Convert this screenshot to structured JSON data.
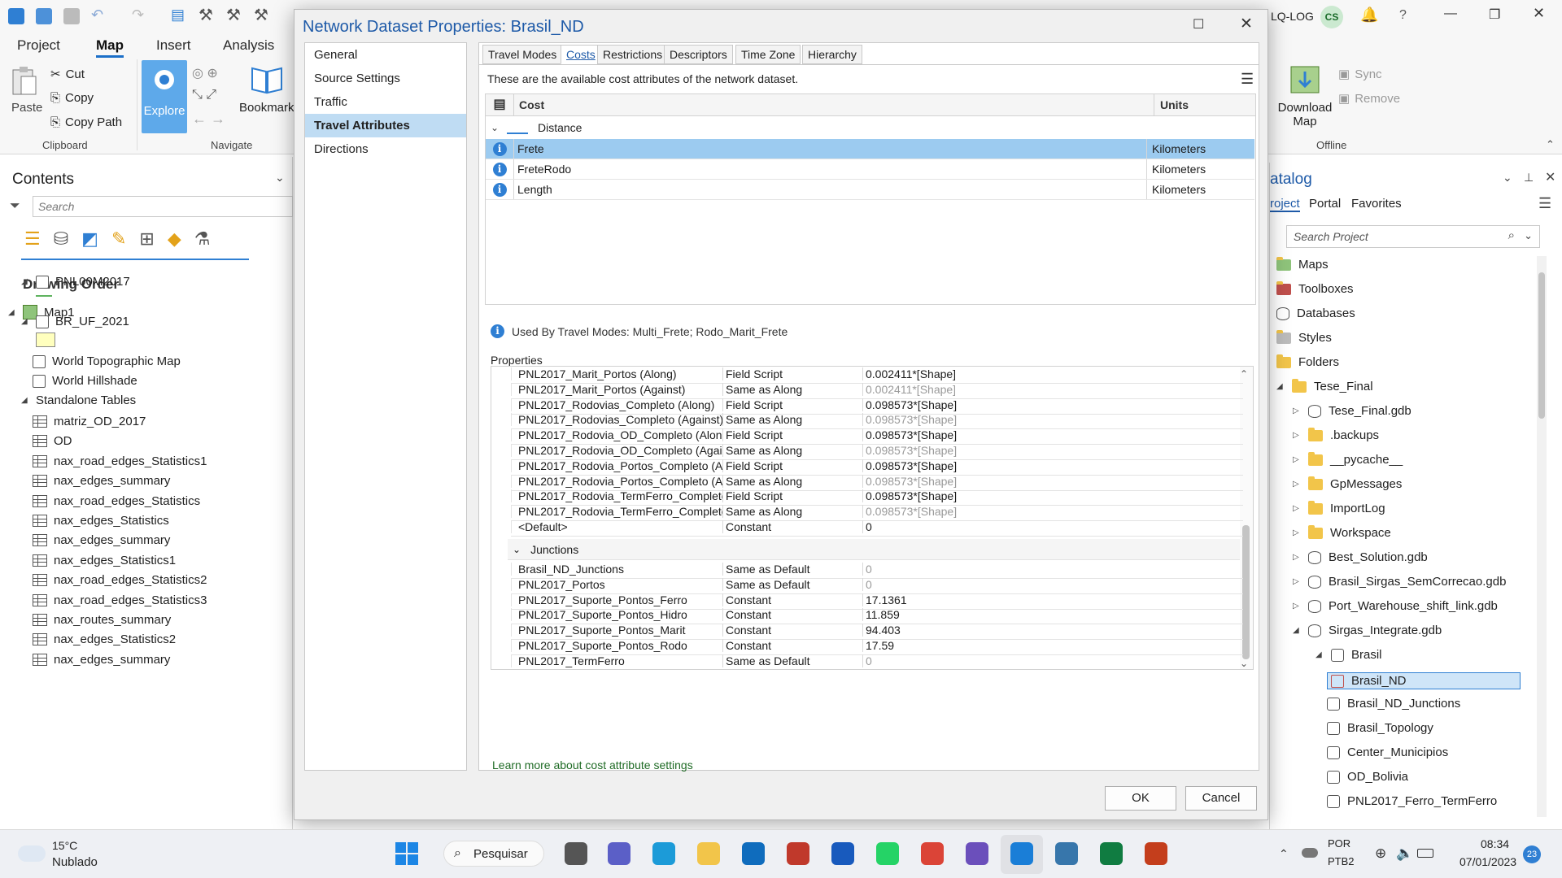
{
  "ribbon": {
    "tabs": [
      "Project",
      "Map",
      "Insert",
      "Analysis"
    ],
    "active_tab": "Map",
    "clipboard": {
      "paste": "Paste",
      "cut": "Cut",
      "copy": "Copy",
      "copy_path": "Copy Path",
      "group": "Clipboard"
    },
    "navigate": {
      "explore": "Explore",
      "bookmarks": "Bookmarks",
      "group": "Navigate"
    },
    "account": {
      "org": "LQ-LOG",
      "initials": "CS"
    },
    "offline": {
      "download_map": "Download Map",
      "sync": "Sync",
      "remove": "Remove",
      "group": "Offline"
    }
  },
  "contents": {
    "title": "Contents",
    "search_placeholder": "Search",
    "drawing_order": "Drawing Order",
    "map": "Map1",
    "layers": [
      "PNL00M2017",
      "BR_UF_2021",
      "World Topographic Map",
      "World Hillshade"
    ],
    "standalone_header": "Standalone Tables",
    "tables": [
      "matriz_OD_2017",
      "OD",
      "nax_road_edges_Statistics1",
      "nax_edges_summary",
      "nax_road_edges_Statistics",
      "nax_edges_Statistics",
      "nax_edges_summary",
      "nax_edges_Statistics1",
      "nax_road_edges_Statistics2",
      "nax_road_edges_Statistics3",
      "nax_routes_summary",
      "nax_edges_Statistics2",
      "nax_edges_summary"
    ]
  },
  "catalog": {
    "title": "atalog",
    "tabs": [
      "roject",
      "Portal",
      "Favorites"
    ],
    "search_placeholder": "Search Project",
    "items": [
      {
        "label": "Maps",
        "icon": "map-icon"
      },
      {
        "label": "Toolboxes",
        "icon": "toolbox-icon"
      },
      {
        "label": "Databases",
        "icon": "database-icon"
      },
      {
        "label": "Styles",
        "icon": "style-icon"
      },
      {
        "label": "Folders",
        "icon": "folder-icon"
      },
      {
        "label": "Tese_Final",
        "icon": "folder-icon"
      },
      {
        "label": "Tese_Final.gdb",
        "icon": "database-icon"
      },
      {
        "label": ".backups",
        "icon": "folder-icon"
      },
      {
        "label": "__pycache__",
        "icon": "folder-icon"
      },
      {
        "label": "GpMessages",
        "icon": "folder-icon"
      },
      {
        "label": "ImportLog",
        "icon": "folder-icon"
      },
      {
        "label": "Workspace",
        "icon": "folder-icon"
      },
      {
        "label": "Best_Solution.gdb",
        "icon": "database-icon"
      },
      {
        "label": "Brasil_Sirgas_SemCorrecao.gdb",
        "icon": "database-icon"
      },
      {
        "label": "Port_Warehouse_shift_link.gdb",
        "icon": "database-icon"
      },
      {
        "label": "Sirgas_Integrate.gdb",
        "icon": "database-icon"
      },
      {
        "label": "Brasil",
        "icon": "feature-dataset-icon"
      },
      {
        "label": "Brasil_ND",
        "icon": "network-dataset-icon"
      },
      {
        "label": "Brasil_ND_Junctions",
        "icon": "point-fc-icon"
      },
      {
        "label": "Brasil_Topology",
        "icon": "topology-icon"
      },
      {
        "label": "Center_Municipios",
        "icon": "point-fc-icon"
      },
      {
        "label": "OD_Bolivia",
        "icon": "point-fc-icon"
      },
      {
        "label": "PNL2017_Ferro_TermFerro",
        "icon": "point-fc-icon"
      }
    ]
  },
  "dialog": {
    "title": "Network Dataset Properties: Brasil_ND",
    "nav": [
      "General",
      "Source Settings",
      "Traffic",
      "Travel Attributes",
      "Directions"
    ],
    "nav_selected": "Travel Attributes",
    "tabs": [
      "Travel Modes",
      "Costs",
      "Restrictions",
      "Descriptors",
      "Time Zone",
      "Hierarchy"
    ],
    "active_tab": "Costs",
    "description": "These are the available cost attributes of the network dataset.",
    "cost_header": "Cost",
    "units_header": "Units",
    "group": "Distance",
    "costs": [
      {
        "name": "Frete",
        "units": "Kilometers"
      },
      {
        "name": "FreteRodo",
        "units": "Kilometers"
      },
      {
        "name": "Length",
        "units": "Kilometers"
      }
    ],
    "used_by": "Used By Travel Modes: Multi_Frete; Rodo_Marit_Frete",
    "properties_label": "Properties",
    "edge_rows": [
      {
        "source": "PNL2017_Marit_Portos (Along)",
        "type": "Field Script",
        "value": "0.002411*[Shape]",
        "dim": false
      },
      {
        "source": "PNL2017_Marit_Portos (Against)",
        "type": "Same as Along",
        "value": "0.002411*[Shape]",
        "dim": true
      },
      {
        "source": "PNL2017_Rodovias_Completo (Along)",
        "type": "Field Script",
        "value": "0.098573*[Shape]",
        "dim": false
      },
      {
        "source": "PNL2017_Rodovias_Completo (Against)",
        "type": "Same as Along",
        "value": "0.098573*[Shape]",
        "dim": true
      },
      {
        "source": "PNL2017_Rodovia_OD_Completo (Along",
        "type": "Field Script",
        "value": "0.098573*[Shape]",
        "dim": false
      },
      {
        "source": "PNL2017_Rodovia_OD_Completo (Agair",
        "type": "Same as Along",
        "value": "0.098573*[Shape]",
        "dim": true
      },
      {
        "source": "PNL2017_Rodovia_Portos_Completo (Al",
        "type": "Field Script",
        "value": "0.098573*[Shape]",
        "dim": false
      },
      {
        "source": "PNL2017_Rodovia_Portos_Completo (Ag",
        "type": "Same as Along",
        "value": "0.098573*[Shape]",
        "dim": true
      },
      {
        "source": "PNL2017_Rodovia_TermFerro_Completo",
        "type": "Field Script",
        "value": "0.098573*[Shape]",
        "dim": false
      },
      {
        "source": "PNL2017_Rodovia_TermFerro_Completo",
        "type": "Same as Along",
        "value": "0.098573*[Shape]",
        "dim": true
      },
      {
        "source": "<Default>",
        "type": "Constant",
        "value": "0",
        "dim": false
      }
    ],
    "junctions_label": "Junctions",
    "junction_rows": [
      {
        "source": "Brasil_ND_Junctions",
        "type": "Same as Default",
        "value": "0",
        "dim": true
      },
      {
        "source": "PNL2017_Portos",
        "type": "Same as Default",
        "value": "0",
        "dim": true
      },
      {
        "source": "PNL2017_Suporte_Pontos_Ferro",
        "type": "Constant",
        "value": "17.1361",
        "dim": false
      },
      {
        "source": "PNL2017_Suporte_Pontos_Hidro",
        "type": "Constant",
        "value": "11.859",
        "dim": false
      },
      {
        "source": "PNL2017_Suporte_Pontos_Marit",
        "type": "Constant",
        "value": "94.403",
        "dim": false
      },
      {
        "source": "PNL2017_Suporte_Pontos_Rodo",
        "type": "Constant",
        "value": "17.59",
        "dim": false
      },
      {
        "source": "PNL2017_TermFerro",
        "type": "Same as Default",
        "value": "0",
        "dim": true
      }
    ],
    "learn_more": "Learn more about cost attribute settings",
    "ok": "OK",
    "cancel": "Cancel"
  },
  "taskbar": {
    "weather_temp": "15°C",
    "weather_desc": "Nublado",
    "search": "Pesquisar",
    "lang": "POR",
    "layout": "PTB2",
    "time": "08:34",
    "date": "07/01/2023",
    "notifications": "23"
  }
}
